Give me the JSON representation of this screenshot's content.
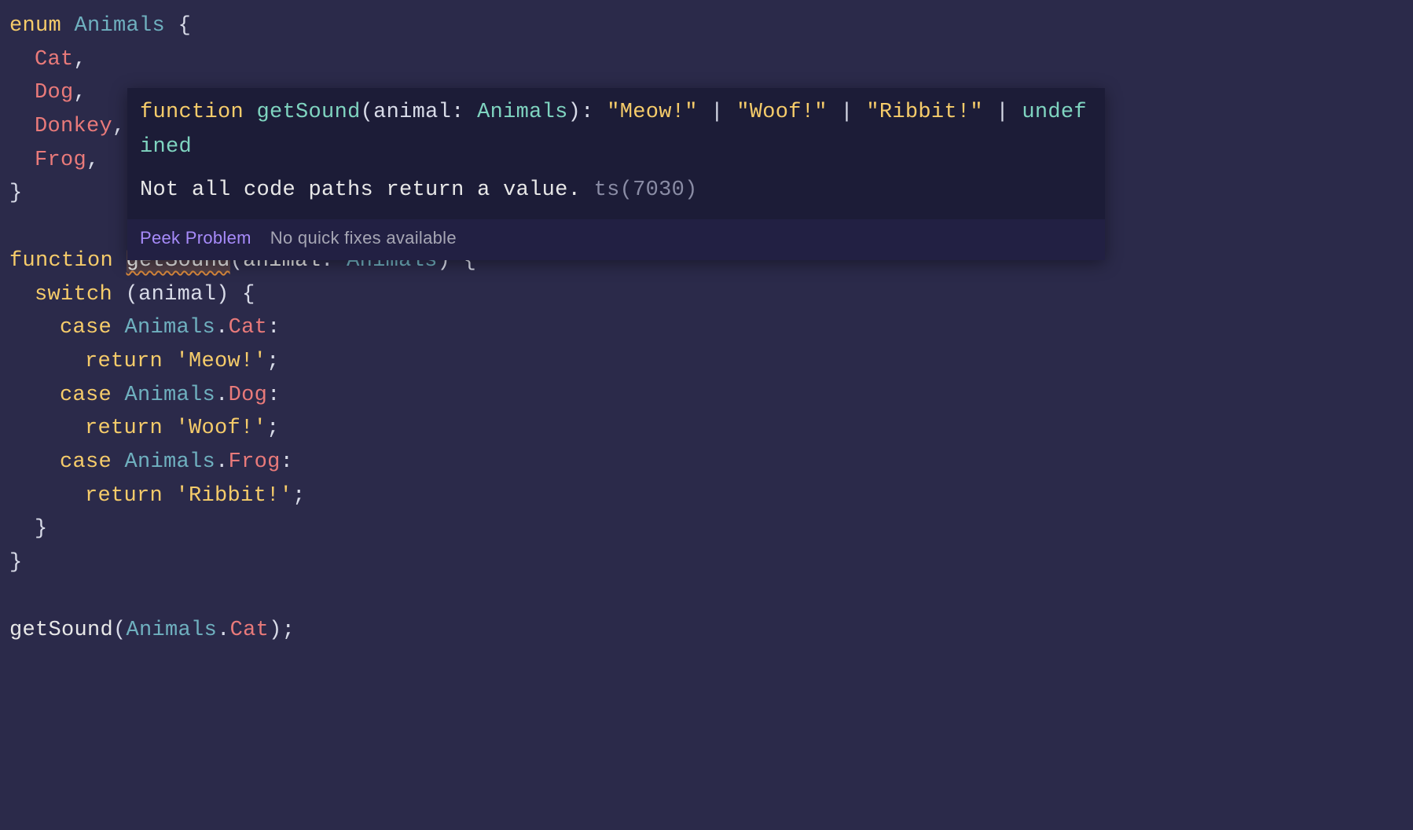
{
  "code": {
    "kw_enum": "enum",
    "enum_name": "Animals",
    "members": {
      "m0": "Cat",
      "m1": "Dog",
      "m2": "Donkey",
      "m3": "Frog"
    },
    "kw_function": "function",
    "func_name": "getSound",
    "param_name": "animal",
    "param_type": "Animals",
    "kw_switch": "switch",
    "switch_expr": "animal",
    "kw_case": "case",
    "case0_enum": "Animals",
    "case0_mem": "Cat",
    "case0_ret": "'Meow!'",
    "case1_enum": "Animals",
    "case1_mem": "Dog",
    "case1_ret": "'Woof!'",
    "case2_enum": "Animals",
    "case2_mem": "Frog",
    "case2_ret": "'Ribbit!'",
    "kw_return": "return",
    "call_fn": "getSound",
    "call_enum": "Animals",
    "call_mem": "Cat"
  },
  "hover": {
    "sig_kw": "function",
    "sig_fn": "getSound",
    "sig_param": "animal",
    "sig_param_ty": "Animals",
    "sig_ret_l0": "\"Meow!\"",
    "sig_ret_l1": "\"Woof!\"",
    "sig_ret_l2": "\"Ribbit!\"",
    "sig_ret_undef": "undefined",
    "msg_text": "Not all code paths return a value.",
    "msg_code": "ts(7030)",
    "action_peek": "Peek Problem",
    "action_nofix": "No quick fixes available"
  }
}
